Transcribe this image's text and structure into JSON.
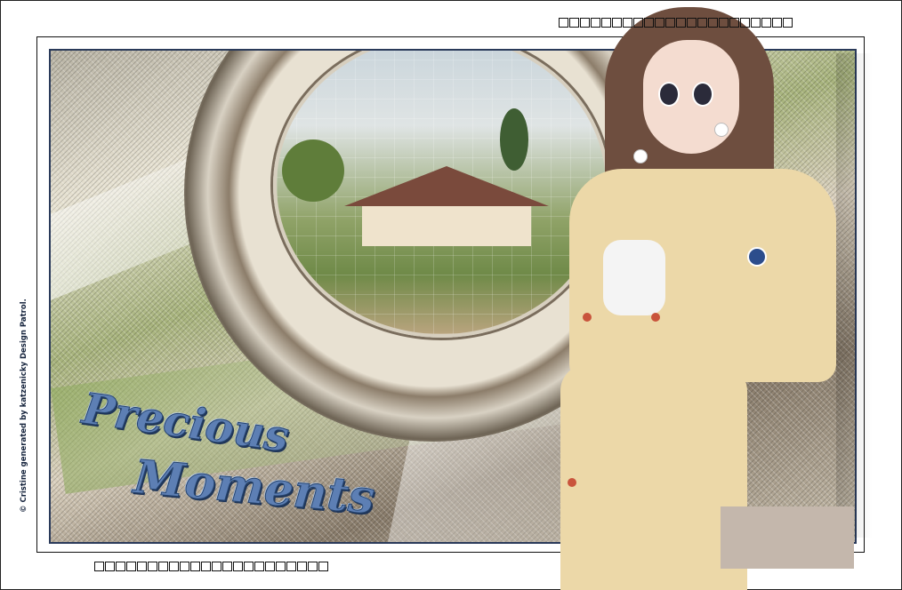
{
  "title": {
    "line1": "Precious",
    "line2": "Moments"
  },
  "credit": "© Cristine generated by katzenicky Design Patrol.",
  "placeholder_glyphs": {
    "top_count": 22,
    "bottom_count": 22
  },
  "colors": {
    "title_blue": "#5d7fb4",
    "title_outline": "#27456f",
    "frame_border": "#2a3a5a",
    "jacket": "#ecd8a8",
    "hair": "#6e4e3f"
  },
  "icons": [
    "tunnel-graphic",
    "house-scene",
    "girl-illustration",
    "placeholder-box"
  ]
}
